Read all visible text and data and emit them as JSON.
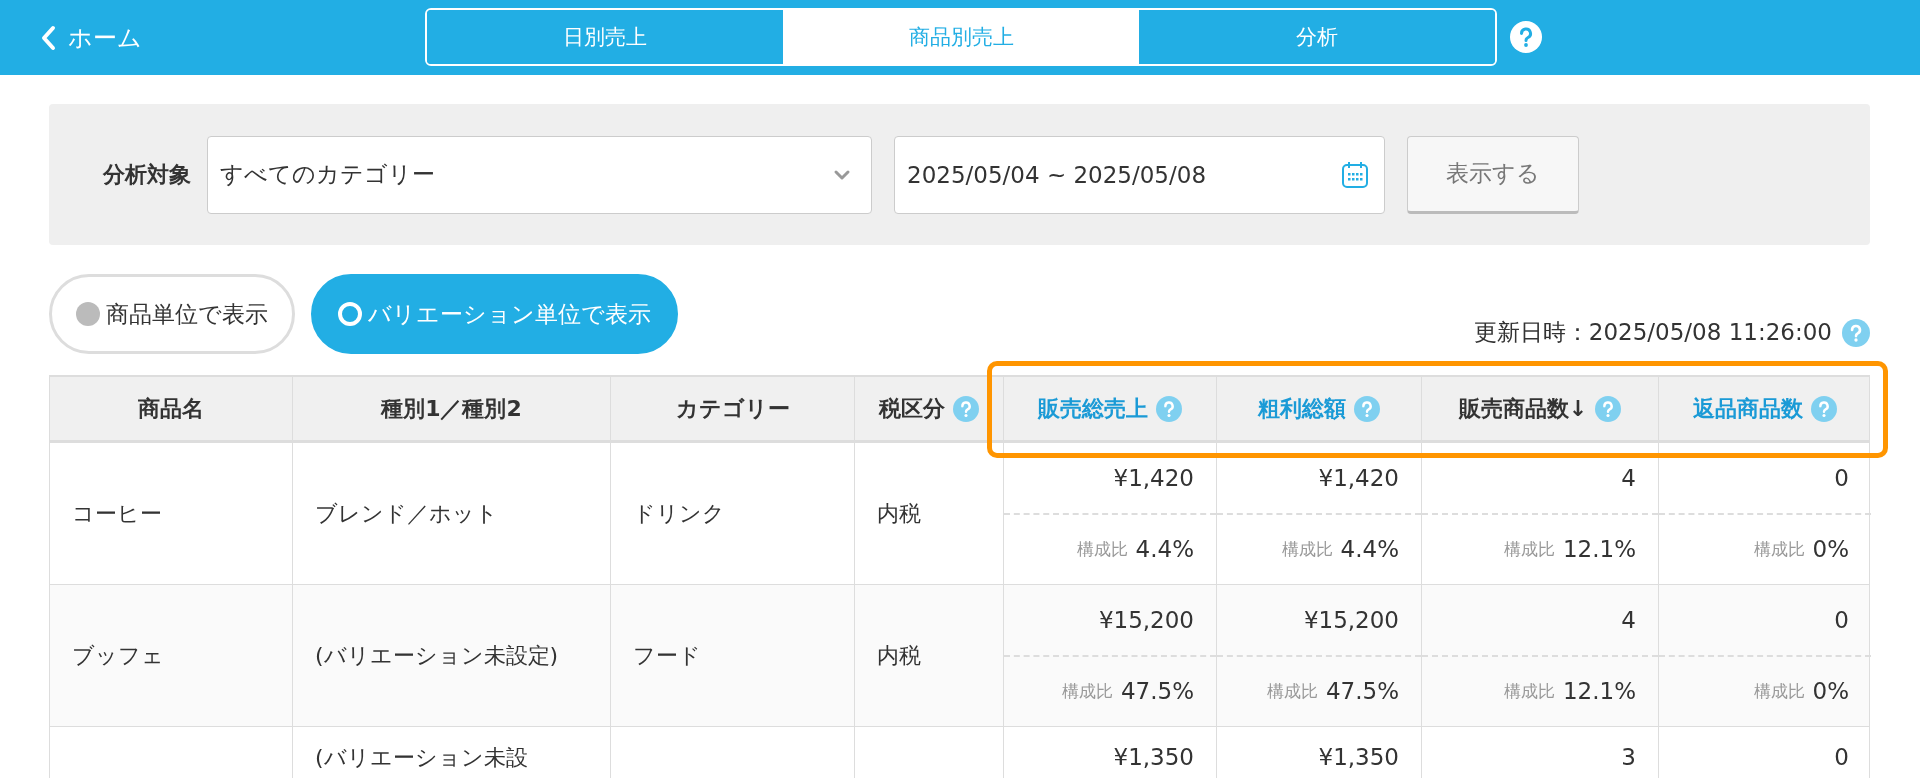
{
  "nav": {
    "back": "ホーム",
    "tabs": [
      {
        "label": "日別売上",
        "selected": false
      },
      {
        "label": "商品別売上",
        "selected": true
      },
      {
        "label": "分析",
        "selected": false
      }
    ]
  },
  "filter": {
    "label": "分析対象",
    "category": "すべてのカテゴリー",
    "date_range": "2025/05/04 ~ 2025/05/08",
    "button": "表示する"
  },
  "view_toggle": [
    {
      "label": "商品単位で表示",
      "selected": false
    },
    {
      "label": "バリエーション単位で表示",
      "selected": true
    }
  ],
  "updated": "更新日時：2025/05/08 11:26:00",
  "table": {
    "columns": [
      {
        "label": "商品名",
        "kind": "text",
        "help": false,
        "highlighted": false
      },
      {
        "label": "種別1／種別2",
        "kind": "text",
        "help": false,
        "highlighted": false
      },
      {
        "label": "カテゴリー",
        "kind": "text",
        "help": false,
        "highlighted": false
      },
      {
        "label": "税区分",
        "kind": "text",
        "help": true,
        "highlighted": false
      },
      {
        "label": "販売総売上",
        "kind": "sortable",
        "help": true,
        "highlighted": true,
        "selected": false
      },
      {
        "label": "粗利総額",
        "kind": "sortable",
        "help": true,
        "highlighted": true,
        "selected": false
      },
      {
        "label": "販売商品数",
        "kind": "sortable",
        "help": true,
        "highlighted": true,
        "selected": true,
        "sort_mark": "↓"
      },
      {
        "label": "返品商品数",
        "kind": "sortable",
        "help": true,
        "highlighted": true,
        "selected": false
      }
    ],
    "rows": [
      {
        "name": "コーヒー",
        "variation": "ブレンド／ホット",
        "category": "ドリンク",
        "tax": "内税",
        "metrics": [
          {
            "value": "¥1,420",
            "ratio_label": "構成比",
            "ratio": "4.4%"
          },
          {
            "value": "¥1,420",
            "ratio_label": "構成比",
            "ratio": "4.4%"
          },
          {
            "value": "4",
            "ratio_label": "構成比",
            "ratio": "12.1%"
          },
          {
            "value": "0",
            "ratio_label": "構成比",
            "ratio": "0%"
          }
        ]
      },
      {
        "name": "ブッフェ",
        "variation": "(バリエーション未設定)",
        "category": "フード",
        "tax": "内税",
        "metrics": [
          {
            "value": "¥15,200",
            "ratio_label": "構成比",
            "ratio": "47.5%"
          },
          {
            "value": "¥15,200",
            "ratio_label": "構成比",
            "ratio": "47.5%"
          },
          {
            "value": "4",
            "ratio_label": "構成比",
            "ratio": "12.1%"
          },
          {
            "value": "0",
            "ratio_label": "構成比",
            "ratio": "0%"
          }
        ]
      },
      {
        "variation": "(バリエーション未設",
        "metrics": [
          {
            "value": "¥1,350"
          },
          {
            "value": "¥1,350"
          },
          {
            "value": "3"
          },
          {
            "value": "0"
          }
        ]
      }
    ]
  }
}
